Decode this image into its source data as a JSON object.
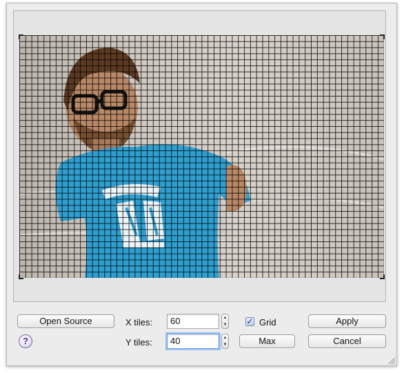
{
  "preview": {
    "grid_columns": 60,
    "grid_rows": 40,
    "grid_visible": true
  },
  "buttons": {
    "open_source": "Open Source",
    "apply": "Apply",
    "max": "Max",
    "cancel": "Cancel"
  },
  "fields": {
    "x_tiles_label": "X tiles:",
    "x_tiles_value": "60",
    "y_tiles_label": "Y tiles:",
    "y_tiles_value": "40"
  },
  "grid_toggle": {
    "label": "Grid",
    "checked": true
  },
  "help": {
    "glyph": "?"
  },
  "icons": {
    "help": "question-mark-icon",
    "stepper": "up-down-arrow-icon",
    "resize": "resize-grip-icon",
    "check": "checkmark-icon"
  },
  "colors": {
    "window_bg": "#ececec",
    "focus_ring": "#9cc1f2",
    "shirt": "#2f9fd0"
  }
}
